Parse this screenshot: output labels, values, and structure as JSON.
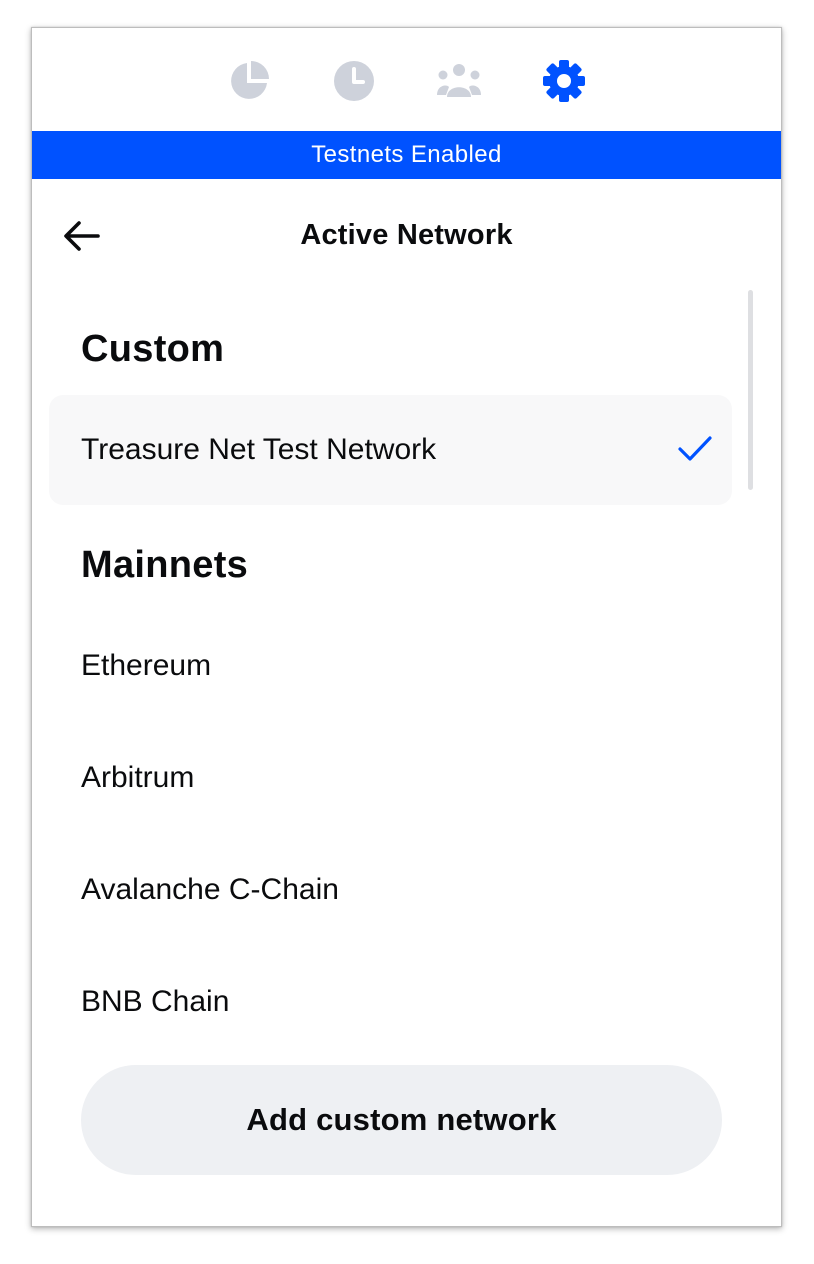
{
  "colors": {
    "accent": "#0052ff",
    "inactive_icon": "#ced2db",
    "selected_row_bg": "#f8f8f9",
    "button_bg": "#eef0f3"
  },
  "tabs": [
    {
      "icon": "pie-chart-icon",
      "active": false
    },
    {
      "icon": "clock-icon",
      "active": false
    },
    {
      "icon": "people-icon",
      "active": false
    },
    {
      "icon": "gear-icon",
      "active": true
    }
  ],
  "banner": {
    "text": "Testnets Enabled"
  },
  "header": {
    "title": "Active Network",
    "back_icon": "back-arrow-icon"
  },
  "sections": {
    "custom": {
      "title": "Custom",
      "items": [
        {
          "label": "Treasure Net Test Network",
          "selected": true
        }
      ]
    },
    "mainnets": {
      "title": "Mainnets",
      "items": [
        {
          "label": "Ethereum"
        },
        {
          "label": "Arbitrum"
        },
        {
          "label": "Avalanche C-Chain"
        },
        {
          "label": "BNB Chain"
        }
      ]
    }
  },
  "add_button": {
    "label": "Add custom network"
  }
}
